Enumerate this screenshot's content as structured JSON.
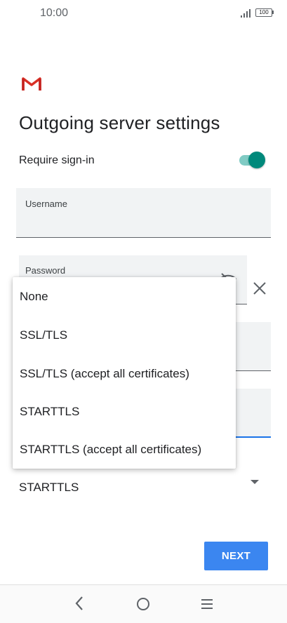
{
  "status_bar": {
    "time": "10:00",
    "battery": "100"
  },
  "page": {
    "title": "Outgoing server settings"
  },
  "require_sign_in": {
    "label": "Require sign-in",
    "enabled": true
  },
  "fields": {
    "username": {
      "label": "Username",
      "value": ""
    },
    "password": {
      "label": "Password",
      "value": ""
    }
  },
  "security_type": {
    "selected": "STARTTLS",
    "options": [
      "None",
      "SSL/TLS",
      "SSL/TLS (accept all certificates)",
      "STARTTLS",
      "STARTTLS (accept all certificates)"
    ]
  },
  "next_button": {
    "label": "NEXT"
  },
  "colors": {
    "accent": "#3b86f0",
    "toggle": "#00897b",
    "gmail_red": "#d93025"
  },
  "icons": [
    "signal-icon",
    "battery-icon",
    "gmail-logo",
    "visibility-off-icon",
    "close-icon",
    "dropdown-arrow-icon",
    "nav-back-icon",
    "nav-home-icon",
    "nav-menu-icon"
  ]
}
